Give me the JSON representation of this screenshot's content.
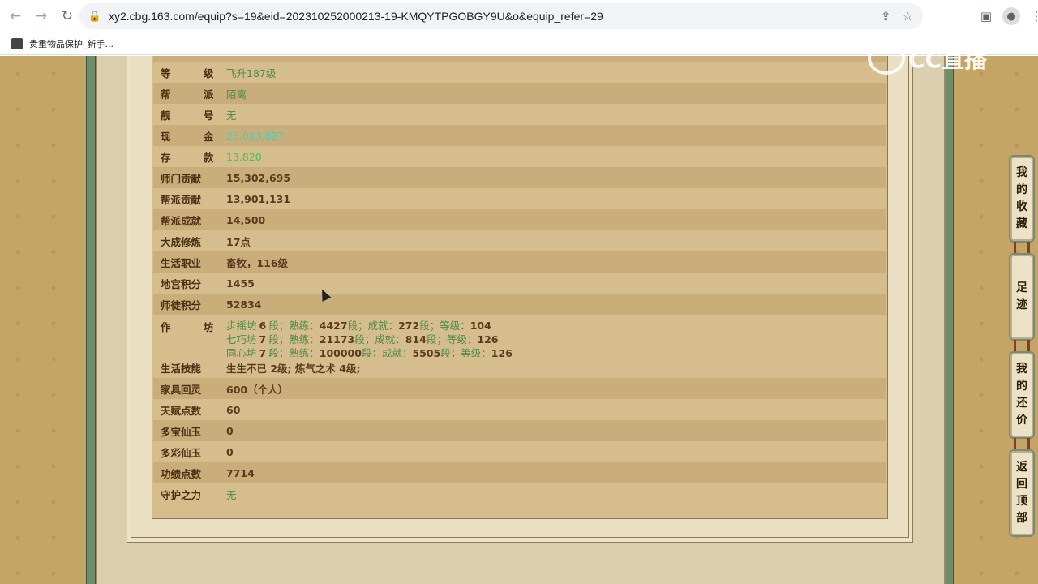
{
  "browser": {
    "url": "xy2.cbg.163.com/equip?s=19&eid=202310252000213-19-KMQYTPGOBGY9U&o&equip_refer=29",
    "bookmark_label": "贵重物品保护_新手..."
  },
  "watermark": {
    "text": "CC直播"
  },
  "rows": [
    {
      "label": "等  级",
      "value": "飞升187级",
      "style": "green"
    },
    {
      "label": "帮  派",
      "value": "陌离",
      "style": "green"
    },
    {
      "label": "靓  号",
      "value": "无",
      "style": "green"
    },
    {
      "label": "现  金",
      "value": "23,013,827",
      "style": "cyan"
    },
    {
      "label": "存  款",
      "value": "13,820",
      "style": "lime"
    },
    {
      "label": "师门贡献",
      "value": "15,302,695",
      "style": "bold"
    },
    {
      "label": "帮派贡献",
      "value": "13,901,131",
      "style": "bold"
    },
    {
      "label": "帮派成就",
      "value": "14,500",
      "style": "bold"
    },
    {
      "label": "大成修炼",
      "value": "17点",
      "style": "bold"
    },
    {
      "label": "生活职业",
      "value": "畜牧，116级",
      "style": "bold"
    },
    {
      "label": "地宫积分",
      "value": "1455",
      "style": "bold"
    },
    {
      "label": "师徒积分",
      "value": "52834",
      "style": "bold"
    }
  ],
  "workshop": {
    "label": "作  坊",
    "lines": [
      {
        "name": "步摇坊",
        "dan": "6",
        "shulian": "4427",
        "chengjiu": "272",
        "dengji": "104"
      },
      {
        "name": "七巧坊",
        "dan": "7",
        "shulian": "21173",
        "chengjiu": "814",
        "dengji": "126"
      },
      {
        "name": "同心坊",
        "dan": "7",
        "shulian": "100000",
        "chengjiu": "5505",
        "dengji": "126"
      }
    ],
    "unit_dan": "段；",
    "lbl_shulian": "熟练：",
    "lbl_chengjiu": "成就：",
    "lbl_dengji": "等级："
  },
  "rows2": [
    {
      "label": "生活技能",
      "value": "生生不已 2级; 炼气之术 4级;",
      "style": "bold"
    },
    {
      "label": "家具回灵",
      "value": "600（个人）",
      "style": "bold"
    },
    {
      "label": "天赋点数",
      "value": "60",
      "style": "bold"
    },
    {
      "label": "多宝仙玉",
      "value": "0",
      "style": "bold"
    },
    {
      "label": "多彩仙玉",
      "value": "0",
      "style": "bold"
    },
    {
      "label": "功绩点数",
      "value": "7714",
      "style": "bold"
    },
    {
      "label": "守护之力",
      "value": "无",
      "style": "green"
    }
  ],
  "side_tabs": [
    {
      "chars": [
        "我",
        "的",
        "收",
        "藏"
      ]
    },
    {
      "chars": [
        "足",
        "迹"
      ]
    },
    {
      "chars": [
        "我",
        "的",
        "还",
        "价"
      ]
    },
    {
      "chars": [
        "返",
        "回",
        "顶",
        "部"
      ]
    }
  ]
}
